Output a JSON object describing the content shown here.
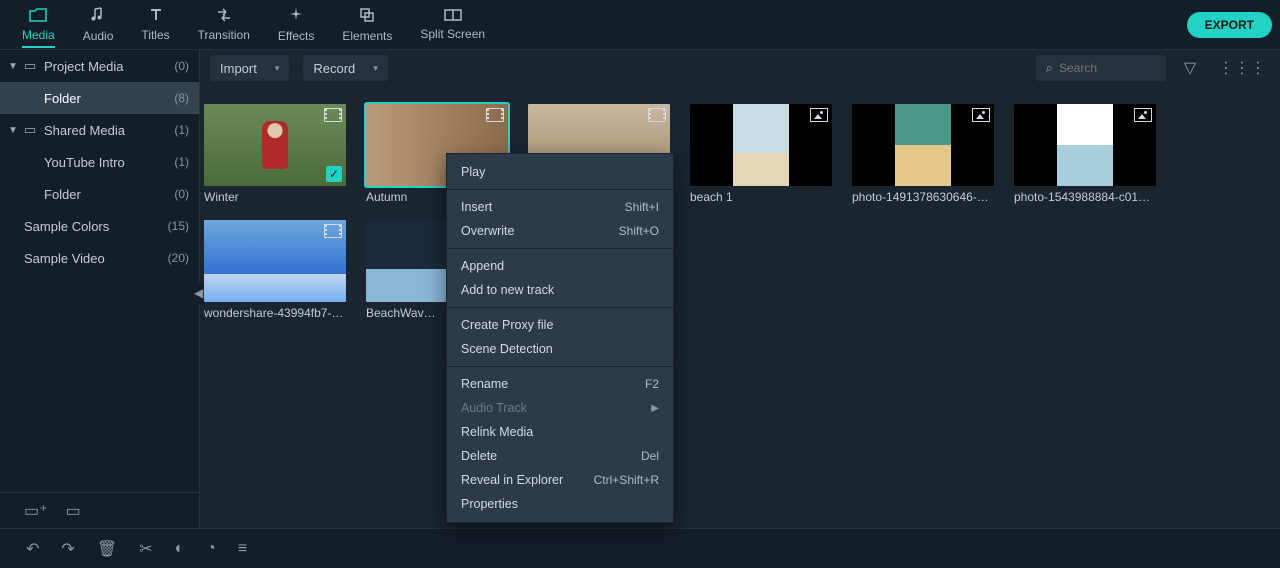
{
  "top_tabs": [
    {
      "icon": "folder",
      "label": "Media",
      "active": true
    },
    {
      "icon": "note",
      "label": "Audio",
      "active": false
    },
    {
      "icon": "T",
      "label": "Titles",
      "active": false
    },
    {
      "icon": "trans",
      "label": "Transition",
      "active": false
    },
    {
      "icon": "spark",
      "label": "Effects",
      "active": false
    },
    {
      "icon": "elem",
      "label": "Elements",
      "active": false
    },
    {
      "icon": "split",
      "label": "Split Screen",
      "active": false
    }
  ],
  "export_label": "EXPORT",
  "sidebar": {
    "items": [
      {
        "name": "Project Media",
        "count": "(0)",
        "indent": 0,
        "chev": true,
        "folder": true,
        "sel": false
      },
      {
        "name": "Folder",
        "count": "(8)",
        "indent": 1,
        "chev": false,
        "folder": false,
        "sel": true
      },
      {
        "name": "Shared Media",
        "count": "(1)",
        "indent": 0,
        "chev": true,
        "folder": true,
        "sel": false
      },
      {
        "name": "YouTube Intro",
        "count": "(1)",
        "indent": 1,
        "chev": false,
        "folder": false,
        "sel": false
      },
      {
        "name": "Folder",
        "count": "(0)",
        "indent": 1,
        "chev": false,
        "folder": false,
        "sel": false
      },
      {
        "name": "Sample Colors",
        "count": "(15)",
        "indent": 0,
        "chev": false,
        "folder": false,
        "sel": false
      },
      {
        "name": "Sample Video",
        "count": "(20)",
        "indent": 0,
        "chev": false,
        "folder": false,
        "sel": false
      }
    ]
  },
  "toolbar": {
    "import": "Import",
    "record": "Record",
    "search_placeholder": "Search"
  },
  "clips": [
    {
      "label": "Winter",
      "art": "th-winter",
      "kind": "video",
      "check": true,
      "sel": false
    },
    {
      "label": "Autumn",
      "art": "th-autumn",
      "kind": "video",
      "check": false,
      "sel": true
    },
    {
      "label": "",
      "art": "th-ppl",
      "kind": "video",
      "check": true,
      "sel": false
    },
    {
      "label": "beach 1",
      "art": "th-beach1",
      "kind": "photo",
      "check": false,
      "sel": false
    },
    {
      "label": "photo-1491378630646-34…",
      "art": "th-beach2",
      "kind": "photo",
      "check": false,
      "sel": false
    },
    {
      "label": "photo-1543988884-c01cf…",
      "art": "th-beach3",
      "kind": "photo",
      "check": false,
      "sel": false
    },
    {
      "label": "wondershare-43994fb7-9…",
      "art": "th-surf",
      "kind": "video",
      "check": false,
      "sel": false
    },
    {
      "label": "BeachWav…",
      "art": "th-wave",
      "kind": "video",
      "check": false,
      "sel": false
    }
  ],
  "context_menu": {
    "groups": [
      [
        {
          "label": "Play",
          "shortcut": "",
          "disabled": false,
          "submenu": false
        }
      ],
      [
        {
          "label": "Insert",
          "shortcut": "Shift+I",
          "disabled": false,
          "submenu": false
        },
        {
          "label": "Overwrite",
          "shortcut": "Shift+O",
          "disabled": false,
          "submenu": false
        }
      ],
      [
        {
          "label": "Append",
          "shortcut": "",
          "disabled": false,
          "submenu": false
        },
        {
          "label": "Add to new track",
          "shortcut": "",
          "disabled": false,
          "submenu": false
        }
      ],
      [
        {
          "label": "Create Proxy file",
          "shortcut": "",
          "disabled": false,
          "submenu": false
        },
        {
          "label": "Scene Detection",
          "shortcut": "",
          "disabled": false,
          "submenu": false
        }
      ],
      [
        {
          "label": "Rename",
          "shortcut": "F2",
          "disabled": false,
          "submenu": false
        },
        {
          "label": "Audio Track",
          "shortcut": "",
          "disabled": true,
          "submenu": true
        },
        {
          "label": "Relink Media",
          "shortcut": "",
          "disabled": false,
          "submenu": false
        },
        {
          "label": "Delete",
          "shortcut": "Del",
          "disabled": false,
          "submenu": false
        },
        {
          "label": "Reveal in Explorer",
          "shortcut": "Ctrl+Shift+R",
          "disabled": false,
          "submenu": false
        },
        {
          "label": "Properties",
          "shortcut": "",
          "disabled": false,
          "submenu": false
        }
      ]
    ]
  },
  "icon_glyphs": {
    "folder": "▭",
    "note": "♫",
    "T": "T",
    "trans": "⇄",
    "spark": "✦",
    "elem": "❏",
    "split": "▥",
    "new-folder": "📁",
    "shared-folder": "📂",
    "search": "⌕",
    "filter": "⫧",
    "grid": "⋮⋮",
    "undo": "↶",
    "redo": "↷",
    "trash": "🗑",
    "cut": "✂",
    "color": "◐",
    "timer": "◔",
    "settings": "≡"
  }
}
